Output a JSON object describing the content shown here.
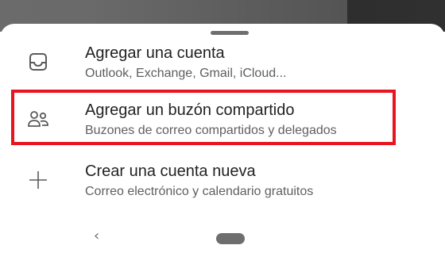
{
  "sheet": {
    "options": [
      {
        "title": "Agregar una cuenta",
        "subtitle": "Outlook, Exchange, Gmail, iCloud...",
        "icon": "inbox-icon"
      },
      {
        "title": "Agregar un buzón compartido",
        "subtitle": "Buzones de correo compartidos y delegados",
        "icon": "people-icon"
      },
      {
        "title": "Crear una cuenta nueva",
        "subtitle": "Correo electrónico y calendario gratuitos",
        "icon": "plus-icon"
      }
    ],
    "highlight_color": "#e8141f"
  },
  "navigation": {
    "back_label": "‹"
  }
}
